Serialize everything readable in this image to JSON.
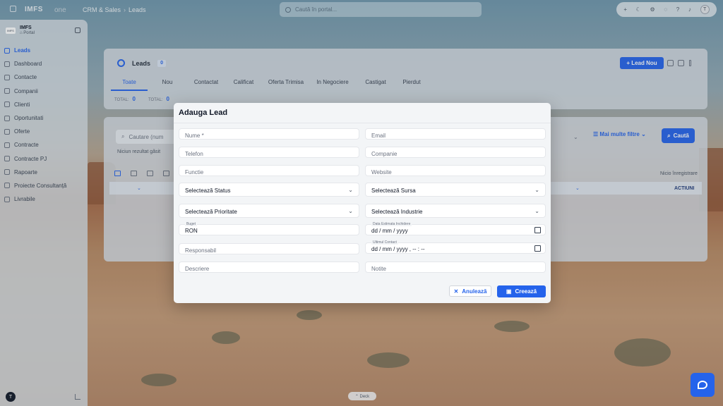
{
  "topbar": {
    "logo": "IMFS",
    "suffix": "one",
    "breadcrumb": [
      "CRM & Sales",
      "Leads"
    ],
    "search_placeholder": "Caută în portal...",
    "avatar": "T"
  },
  "sidebar": {
    "org": "IMFS",
    "portal": "⌂ Portal",
    "items": [
      {
        "label": "Leads",
        "active": true
      },
      {
        "label": "Dashboard"
      },
      {
        "label": "Contacte"
      },
      {
        "label": "Companii"
      },
      {
        "label": "Clienti"
      },
      {
        "label": "Oportunitati"
      },
      {
        "label": "Oferte"
      },
      {
        "label": "Contracte"
      },
      {
        "label": "Contracte PJ"
      },
      {
        "label": "Rapoarte"
      },
      {
        "label": "Proiecte Consultanță"
      },
      {
        "label": "Livrabile"
      }
    ],
    "user_initial": "T"
  },
  "leads_panel": {
    "title": "Leads",
    "count": "0",
    "new_button": "+ Lead Nou",
    "tabs": [
      "Toate",
      "Nou",
      "Contactat",
      "Calificat",
      "Oferta Trimisa",
      "In Negociere",
      "Castigat",
      "Pierdut"
    ],
    "totals": [
      {
        "label": "TOTAL:",
        "value": "0"
      },
      {
        "label": "TOTAL:",
        "value": "0"
      }
    ]
  },
  "filters": {
    "search_placeholder": "Cautare (num",
    "no_result": "Niciun rezultat găsit",
    "more_filters": "Mai multe filtre",
    "search_button": "Caută",
    "records": "Nicio înregistrare",
    "actions_header": "ACTIUNI"
  },
  "modal": {
    "title": "Adauga Lead",
    "fields": {
      "nume": "Nume *",
      "email": "Email",
      "telefon": "Telefon",
      "companie": "Companie",
      "functie": "Functie",
      "website": "Website",
      "status": "Selectează Status",
      "sursa": "Selectează Sursa",
      "prioritate": "Selectează Prioritate",
      "industrie": "Selectează Industrie",
      "buget_label": "Buget",
      "buget_value": "RON",
      "data_label": "Data Estimata Inchidere",
      "data_value": "dd / mm / yyyy",
      "responsabil": "Responsabil",
      "contact_label": "Ultimul Contact",
      "contact_value": "dd / mm / yyyy ,  -- : --",
      "descriere": "Descriere",
      "notite": "Notite"
    },
    "cancel": "Anulează",
    "create": "Creează"
  },
  "deck": "⌃ Deck",
  "colors": {
    "accent": "#2563eb"
  }
}
